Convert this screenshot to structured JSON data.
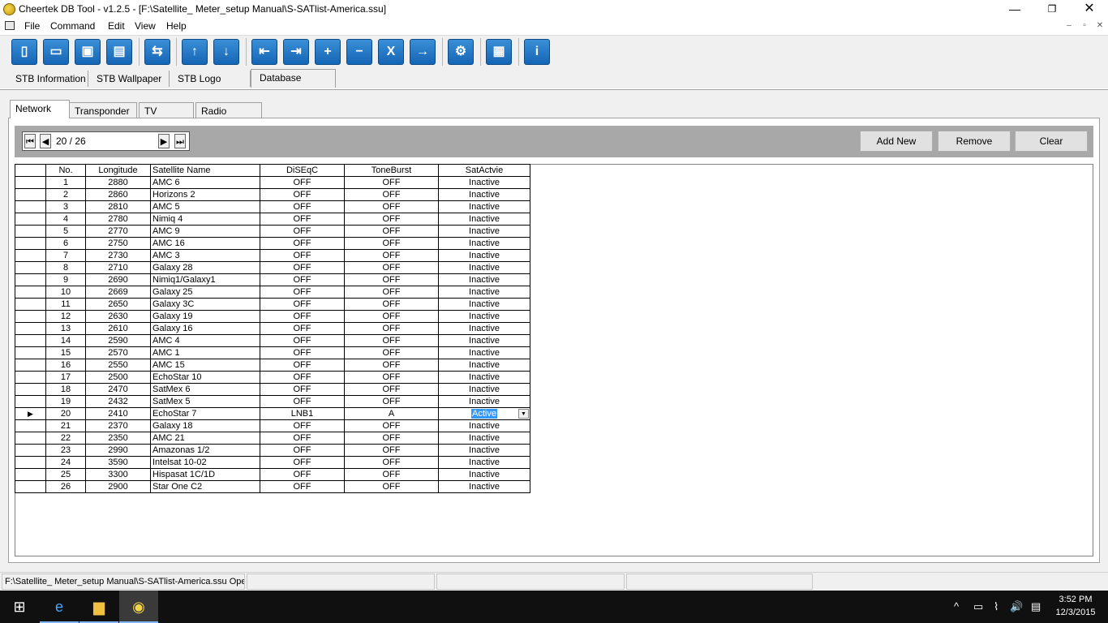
{
  "window": {
    "title": "Cheertek DB Tool - v1.2.5 - [F:\\Satellite_ Meter_setup Manual\\S-SATlist-America.ssu]",
    "minimize": "—",
    "maximize": "❐",
    "close": "✕"
  },
  "menu": {
    "items": [
      "File",
      "Command",
      "Edit",
      "View",
      "Help"
    ],
    "mdi_min": "–",
    "mdi_restore": "▫",
    "mdi_close": "✕"
  },
  "toolbar": {
    "icons": [
      "new-icon",
      "open-icon",
      "save-icon",
      "save-as-icon",
      "convert-icon",
      "move-up-icon",
      "move-down-icon",
      "first-record-icon",
      "last-record-icon",
      "zoom-in-icon",
      "zoom-out-icon",
      "excel-export-icon",
      "forward-icon",
      "settings-icon",
      "database-icon",
      "info-icon"
    ],
    "glyphs": [
      "▯",
      "▭",
      "▣",
      "▤",
      "⇆",
      "↑",
      "↓",
      "⇤",
      "⇥",
      "+",
      "−",
      "X",
      "→",
      "⚙",
      "▦",
      "i"
    ]
  },
  "top_tabs": [
    "STB Information",
    "STB Wallpaper",
    "STB Logo",
    "Database"
  ],
  "inner_tabs": [
    "Network",
    "Transponder",
    "TV Channel",
    "Radio Channel"
  ],
  "navigator": {
    "position": "20 / 26",
    "first": "⏮",
    "prev": "◀",
    "next": "▶",
    "last": "⏭"
  },
  "buttons": {
    "add_new": "Add New",
    "remove": "Remove",
    "clear": "Clear"
  },
  "grid": {
    "columns": [
      "No.",
      "Longitude",
      "Satellite Name",
      "DiSEqC",
      "ToneBurst",
      "SatActvie"
    ],
    "current_row_marker": "▶",
    "selected_row_index": 19,
    "rows": [
      [
        "1",
        "2880",
        "AMC 6",
        "OFF",
        "OFF",
        "Inactive"
      ],
      [
        "2",
        "2860",
        "Horizons 2",
        "OFF",
        "OFF",
        "Inactive"
      ],
      [
        "3",
        "2810",
        "AMC 5",
        "OFF",
        "OFF",
        "Inactive"
      ],
      [
        "4",
        "2780",
        "Nimiq 4",
        "OFF",
        "OFF",
        "Inactive"
      ],
      [
        "5",
        "2770",
        "AMC 9",
        "OFF",
        "OFF",
        "Inactive"
      ],
      [
        "6",
        "2750",
        "AMC 16",
        "OFF",
        "OFF",
        "Inactive"
      ],
      [
        "7",
        "2730",
        "AMC 3",
        "OFF",
        "OFF",
        "Inactive"
      ],
      [
        "8",
        "2710",
        "Galaxy 28",
        "OFF",
        "OFF",
        "Inactive"
      ],
      [
        "9",
        "2690",
        "Nimiq1/Galaxy1",
        "OFF",
        "OFF",
        "Inactive"
      ],
      [
        "10",
        "2669",
        "Galaxy 25",
        "OFF",
        "OFF",
        "Inactive"
      ],
      [
        "11",
        "2650",
        "Galaxy 3C",
        "OFF",
        "OFF",
        "Inactive"
      ],
      [
        "12",
        "2630",
        "Galaxy 19",
        "OFF",
        "OFF",
        "Inactive"
      ],
      [
        "13",
        "2610",
        "Galaxy 16",
        "OFF",
        "OFF",
        "Inactive"
      ],
      [
        "14",
        "2590",
        "AMC 4",
        "OFF",
        "OFF",
        "Inactive"
      ],
      [
        "15",
        "2570",
        "AMC 1",
        "OFF",
        "OFF",
        "Inactive"
      ],
      [
        "16",
        "2550",
        "AMC 15",
        "OFF",
        "OFF",
        "Inactive"
      ],
      [
        "17",
        "2500",
        "EchoStar 10",
        "OFF",
        "OFF",
        "Inactive"
      ],
      [
        "18",
        "2470",
        "SatMex 6",
        "OFF",
        "OFF",
        "Inactive"
      ],
      [
        "19",
        "2432",
        "SatMex 5",
        "OFF",
        "OFF",
        "Inactive"
      ],
      [
        "20",
        "2410",
        "EchoStar 7",
        "LNB1",
        "A",
        "Active"
      ],
      [
        "21",
        "2370",
        "Galaxy 18",
        "OFF",
        "OFF",
        "Inactive"
      ],
      [
        "22",
        "2350",
        "AMC 21",
        "OFF",
        "OFF",
        "Inactive"
      ],
      [
        "23",
        "2990",
        "Amazonas 1/2",
        "OFF",
        "OFF",
        "Inactive"
      ],
      [
        "24",
        "3590",
        "Intelsat 10-02",
        "OFF",
        "OFF",
        "Inactive"
      ],
      [
        "25",
        "3300",
        "Hispasat 1C/1D",
        "OFF",
        "OFF",
        "Inactive"
      ],
      [
        "26",
        "2900",
        "Star One C2",
        "OFF",
        "OFF",
        "Inactive"
      ]
    ]
  },
  "statusbar": {
    "file_path": "F:\\Satellite_ Meter_setup Manual\\S-SATlist-America.ssu Opened"
  },
  "taskbar": {
    "icons": [
      "windows-start-icon",
      "ie-browser-icon",
      "file-explorer-icon",
      "cheertek-app-icon"
    ],
    "glyphs": [
      "⊞",
      "e",
      "▆",
      "◉"
    ],
    "tray": [
      "^",
      "▭",
      "⌇",
      "🔊",
      "▤"
    ],
    "time": "3:52 PM",
    "date": "12/3/2015"
  },
  "colors": {
    "toolbar_button": "#1f6fc0",
    "selection": "#3399ff",
    "nav_strip": "#a8a8a8",
    "taskbar": "#101010"
  }
}
